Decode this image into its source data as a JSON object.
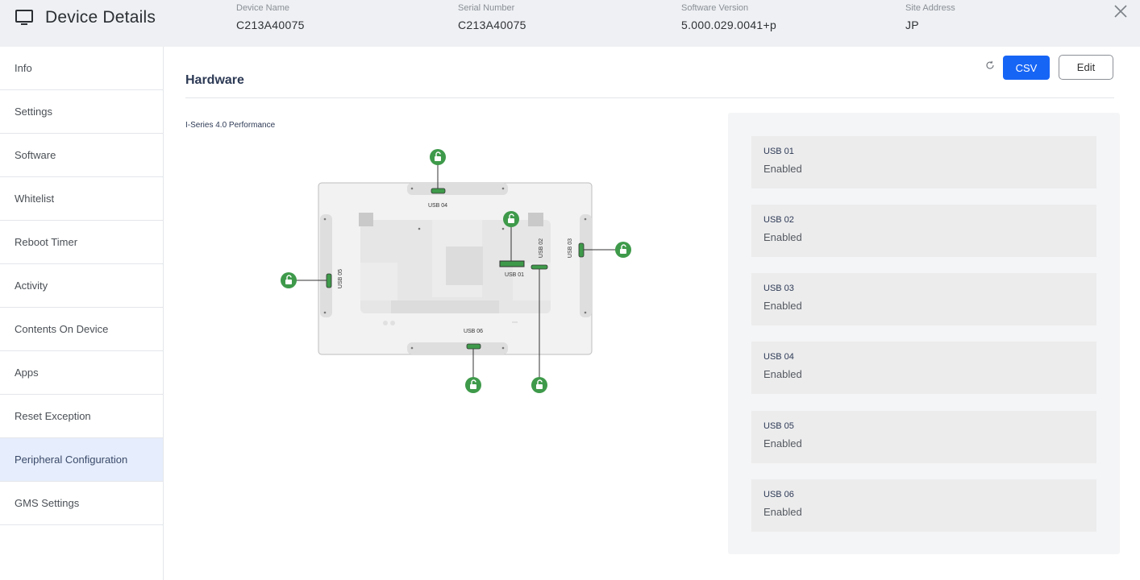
{
  "header": {
    "title": "Device Details",
    "fields": [
      {
        "label": "Device Name",
        "value": "C213A40075"
      },
      {
        "label": "Serial Number",
        "value": "C213A40075"
      },
      {
        "label": "Software Version",
        "value": "5.000.029.0041+p"
      },
      {
        "label": "Site Address",
        "value": "JP"
      }
    ]
  },
  "sidebar": {
    "items": [
      {
        "label": "Info"
      },
      {
        "label": "Settings"
      },
      {
        "label": "Software"
      },
      {
        "label": "Whitelist"
      },
      {
        "label": "Reboot Timer"
      },
      {
        "label": "Activity"
      },
      {
        "label": "Contents On Device"
      },
      {
        "label": "Apps"
      },
      {
        "label": "Reset Exception"
      },
      {
        "label": "Peripheral Configuration"
      },
      {
        "label": "GMS Settings"
      }
    ],
    "active": "Peripheral Configuration"
  },
  "main": {
    "section_title": "Hardware",
    "csv_label": "CSV",
    "edit_label": "Edit",
    "model_label": "I-Series 4.0 Performance",
    "diagram": {
      "port_labels": {
        "usb01": "USB 01",
        "usb02": "USB 02",
        "usb03": "USB 03",
        "usb04": "USB 04",
        "usb05": "USB 05",
        "usb06": "USB 06"
      }
    },
    "usb_ports": [
      {
        "name": "USB 01",
        "status": "Enabled"
      },
      {
        "name": "USB 02",
        "status": "Enabled"
      },
      {
        "name": "USB 03",
        "status": "Enabled"
      },
      {
        "name": "USB 04",
        "status": "Enabled"
      },
      {
        "name": "USB 05",
        "status": "Enabled"
      },
      {
        "name": "USB 06",
        "status": "Enabled"
      }
    ]
  },
  "colors": {
    "accent": "#1765f5",
    "unlock_green": "#3e9a4a",
    "active_sidebar": "#e6edfc"
  }
}
